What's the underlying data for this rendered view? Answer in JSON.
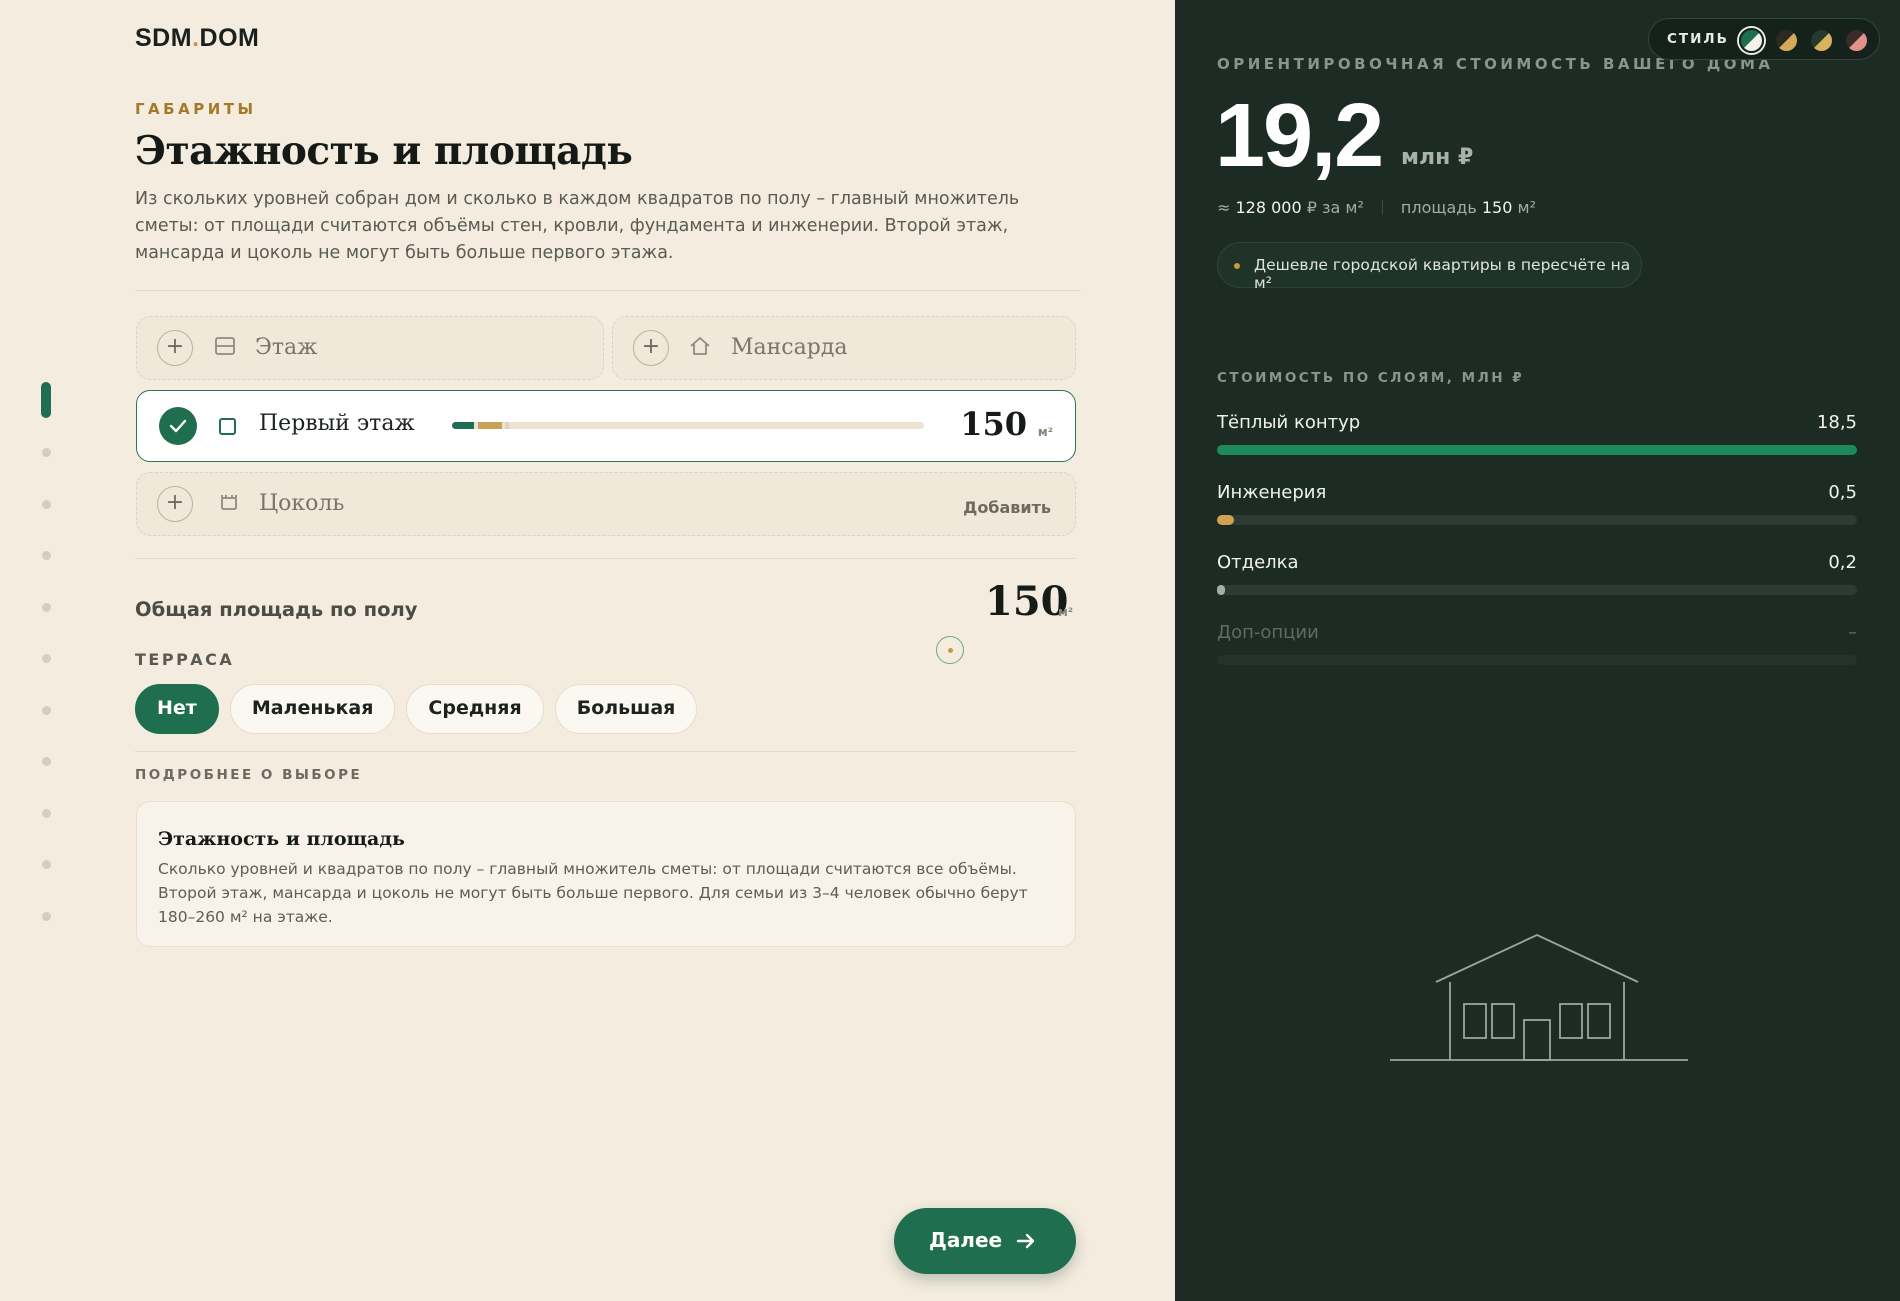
{
  "app": {
    "logo_main": "SDM",
    "logo_dot": ".",
    "logo_suffix": "DOM",
    "progress_fraction": 0.075
  },
  "section": {
    "eyebrow": "ГАБАРИТЫ",
    "title": "Этажность и площадь",
    "lead": "Из скольких уровней собран дом и сколько в каждом квадратов по полу – главный множитель сметы: от площади считаются объёмы стен, кровли, фундамента и инженерии. Второй этаж, мансарда и цоколь не могут быть больше первого этажа."
  },
  "slots": {
    "add_floor": {
      "plus": "+",
      "label": "Этаж",
      "icon": "floor-stack-icon"
    },
    "add_attic": {
      "plus": "+",
      "label": "Мансарда",
      "icon": "house-outline-icon"
    },
    "first_floor": {
      "label": "Первый этаж",
      "value": "150",
      "unit": "м²",
      "icon": "square-icon",
      "fill_fraction": 0.12
    },
    "basement": {
      "plus": "+",
      "label": "Цоколь",
      "action": "Добавить",
      "icon": "basement-icon"
    }
  },
  "total": {
    "label": "Общая площадь по полу",
    "value": "150",
    "unit": "м²"
  },
  "terrace": {
    "eyebrow": "ТЕРРАСА",
    "options": [
      "Нет",
      "Маленькая",
      "Средняя",
      "Большая"
    ],
    "selected": "Нет"
  },
  "details": {
    "eyebrow": "ПОДРОБНЕЕ О ВЫБОРЕ",
    "title": "Этажность и площадь",
    "text": "Сколько уровней и квадратов по полу – главный множитель сметы: от площади считаются все объёмы. Второй этаж, мансарда и цоколь не могут быть больше первого. Для семьи из 3–4 человек обычно берут 180–260 м² на этаже."
  },
  "steps": {
    "count": 11,
    "active_index": 0
  },
  "next_button": {
    "label": "Далее"
  },
  "estimate": {
    "eyebrow": "ОРИЕНТИРОВОЧНАЯ СТОИМОСТЬ ВАШЕГО ДОМА",
    "style_label": "СТИЛЬ",
    "price": "19,2",
    "price_unit": "млн ₽",
    "per_m2_prefix": "≈",
    "per_m2_value": "128 000",
    "per_m2_suffix": "₽ за м²",
    "area_label": "площадь",
    "area_value": "150",
    "area_unit": "м²",
    "note": "Дешевле городской квартиры в пересчёте на м²"
  },
  "layers": {
    "eyebrow": "СТОИМОСТЬ ПО СЛОЯМ, МЛН ₽",
    "items": [
      {
        "name": "Тёплый контур",
        "value": "18,5",
        "fraction": 1.0,
        "color": "#1e8a5c"
      },
      {
        "name": "Инженерия",
        "value": "0,5",
        "fraction": 0.027,
        "color": "#d1a24f"
      },
      {
        "name": "Отделка",
        "value": "0,2",
        "fraction": 0.011,
        "color": "#9fb1a6"
      },
      {
        "name": "Доп-опции",
        "value": "–",
        "fraction": 0,
        "color": "#2c3c33"
      }
    ]
  },
  "colors": {
    "accent": "#1e6e4f",
    "gold": "#c99a3d",
    "panel": "#1c2b24",
    "bg": "#f3ecdf"
  },
  "swatches": [
    {
      "a": "#1e6e4f",
      "b": "#f4f1e8",
      "selected": true
    },
    {
      "a": "#2a2a22",
      "b": "#d4a95b",
      "selected": false
    },
    {
      "a": "#243a2f",
      "b": "#d9b25c",
      "selected": false
    },
    {
      "a": "#3b2a2a",
      "b": "#e0928a",
      "selected": false
    }
  ]
}
